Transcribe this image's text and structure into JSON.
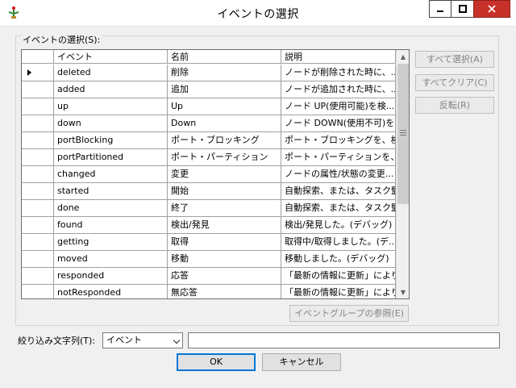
{
  "window": {
    "title": "イベントの選択",
    "controls": {
      "minimize_icon": "minimize-icon",
      "maximize_icon": "maximize-icon",
      "close_icon": "close-icon"
    }
  },
  "group": {
    "label": "イベントの選択(S):"
  },
  "grid": {
    "columns": [
      "イベント",
      "名前",
      "説明"
    ],
    "rows": [
      {
        "selected": true,
        "event": "deleted",
        "name": "削除",
        "description": "ノードが削除された時に、..."
      },
      {
        "event": "added",
        "name": "追加",
        "description": "ノードが追加された時に、..."
      },
      {
        "event": "up",
        "name": "Up",
        "description": "ノード UP(使用可能)を検..."
      },
      {
        "event": "down",
        "name": "Down",
        "description": "ノード DOWN(使用不可)を..."
      },
      {
        "event": "portBlocking",
        "name": "ポート・ブロッキング",
        "description": "ポート・ブロッキングを、検出..."
      },
      {
        "event": "portPartitioned",
        "name": "ポート・パーティション",
        "description": "ポート・パーティションを、検..."
      },
      {
        "event": "changed",
        "name": "変更",
        "description": "ノードの属性/状態の変更..."
      },
      {
        "event": "started",
        "name": "開始",
        "description": "自動探索、または、タスク監..."
      },
      {
        "event": "done",
        "name": "終了",
        "description": "自動探索、または、タスク監..."
      },
      {
        "event": "found",
        "name": "検出/発見",
        "description": "検出/発見した。(デバッグ)"
      },
      {
        "event": "getting",
        "name": "取得",
        "description": "取得中/取得しました。(デ..."
      },
      {
        "event": "moved",
        "name": "移動",
        "description": "移動しました。(デバッグ)"
      },
      {
        "event": "responded",
        "name": "応答",
        "description": "「最新の情報に更新」により..."
      },
      {
        "event": "notResponded",
        "name": "無応答",
        "description": "「最新の情報に更新」により..."
      }
    ]
  },
  "side_buttons": {
    "select_all": "すべて選択(A)",
    "clear_all": "すべてクリア(C)",
    "invert": "反転(R)"
  },
  "event_group_button": "イベントグループの参照(E)",
  "filter": {
    "label": "絞り込み文字列(T):",
    "selected": "イベント",
    "value": ""
  },
  "footer": {
    "ok": "OK",
    "cancel": "キャンセル"
  }
}
